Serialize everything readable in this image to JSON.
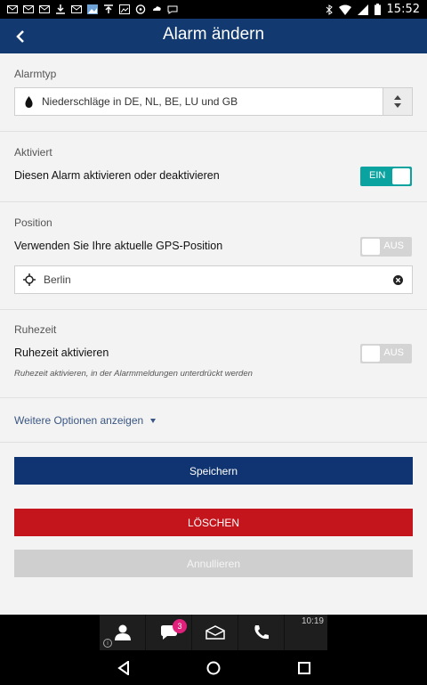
{
  "status_bar": {
    "time": "15:52",
    "left_icons": [
      "mail-icon",
      "mail-icon",
      "mail-icon",
      "download-icon",
      "mail-icon",
      "photo-icon",
      "upload-icon",
      "image-icon",
      "sync-icon",
      "weather-icon",
      "chat-icon"
    ],
    "right_icons": [
      "bluetooth-icon",
      "wifi-icon",
      "signal-icon",
      "battery-icon"
    ]
  },
  "app_bar": {
    "title": "Alarm ändern",
    "back_icon": "chevron-left-icon",
    "color": "#123a70"
  },
  "alarm_type": {
    "label": "Alarmtyp",
    "selected": "Niederschläge in DE, NL, BE, LU und GB",
    "icon": "raindrop-icon"
  },
  "activated": {
    "label": "Aktiviert",
    "text": "Diesen Alarm aktivieren oder deaktivieren",
    "toggle_label": "EIN",
    "is_on": true,
    "toggle_color": "#0aa3a0"
  },
  "position": {
    "label": "Position",
    "text": "Verwenden Sie Ihre aktuelle GPS-Position",
    "toggle_label": "AUS",
    "is_on": false,
    "location_value": "Berlin"
  },
  "quiet_time": {
    "label": "Ruhezeit",
    "text": "Ruhezeit aktivieren",
    "toggle_label": "AUS",
    "is_on": false,
    "note": "Ruhezeit aktivieren, in der Alarmmeldungen unterdrückt werden"
  },
  "more_options": {
    "label": "Weitere Optionen anzeigen"
  },
  "buttons": {
    "save": "Speichern",
    "delete": "LÖSCHEN",
    "cancel": "Annullieren",
    "save_color": "#0f3471",
    "delete_color": "#c4151c"
  },
  "tray": {
    "time": "10:19",
    "chat_badge": "3",
    "info": "i",
    "icons": [
      "contact-icon",
      "chat-icon",
      "mail-icon",
      "phone-icon"
    ]
  },
  "nav_bar": {
    "icons": [
      "back-triangle-icon",
      "home-circle-icon",
      "recents-square-icon"
    ]
  }
}
